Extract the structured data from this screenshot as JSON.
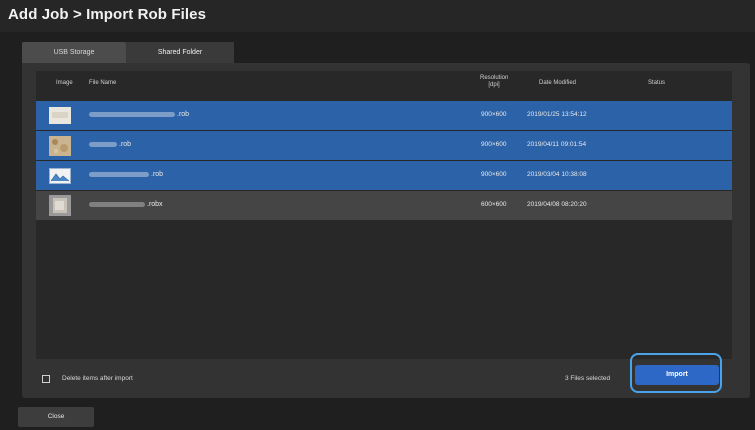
{
  "title": "Add Job > Import Rob Files",
  "tabs": [
    {
      "label": "USB Storage"
    },
    {
      "label": "Shared Folder"
    }
  ],
  "columns": {
    "image": "Image",
    "file_name": "File Name",
    "resolution_line1": "Resolution",
    "resolution_line2": "[dpi]",
    "date_modified": "Date Modified",
    "status": "Status"
  },
  "rows": [
    {
      "file_name": ".rob",
      "resolution": "900×600",
      "date": "2019/01/25 13:54:12",
      "selected": true
    },
    {
      "file_name": ".rob",
      "resolution": "900×600",
      "date": "2019/04/11 09:01:54",
      "selected": true
    },
    {
      "file_name": ".rob",
      "resolution": "900×600",
      "date": "2019/03/04 10:38:08",
      "selected": true
    },
    {
      "file_name": ".robx",
      "resolution": "600×600",
      "date": "2019/04/08 08:20:20",
      "selected": false
    }
  ],
  "footer": {
    "delete_label": "Delete items after import",
    "files_selected": "3 Files selected",
    "import_label": "Import"
  },
  "close_label": "Close",
  "colors": {
    "selected_row": "#2b62a8",
    "import_button": "#2e68c7",
    "highlight_ring": "#4aa3e8"
  }
}
